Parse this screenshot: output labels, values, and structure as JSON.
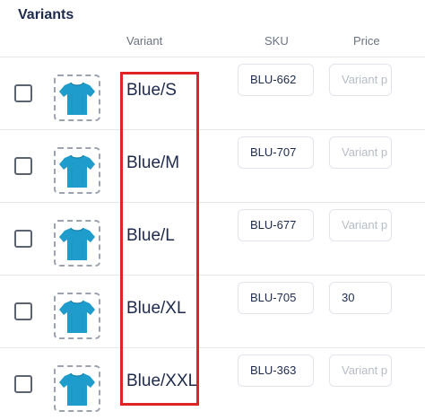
{
  "section": {
    "title": "Variants"
  },
  "columns": {
    "variant": "Variant",
    "sku": "SKU",
    "price": "Price"
  },
  "rows": [
    {
      "variant": "Blue/S",
      "sku": "BLU-662",
      "price": "",
      "price_placeholder": "Variant p"
    },
    {
      "variant": "Blue/M",
      "sku": "BLU-707",
      "price": "",
      "price_placeholder": "Variant p"
    },
    {
      "variant": "Blue/L",
      "sku": "BLU-677",
      "price": "",
      "price_placeholder": "Variant p"
    },
    {
      "variant": "Blue/XL",
      "sku": "BLU-705",
      "price": "30",
      "price_placeholder": "Variant p"
    },
    {
      "variant": "Blue/XXL",
      "sku": "BLU-363",
      "price": "",
      "price_placeholder": "Variant p"
    }
  ],
  "colors": {
    "tshirt": "#1e9ccc",
    "highlight": "#e02424"
  }
}
